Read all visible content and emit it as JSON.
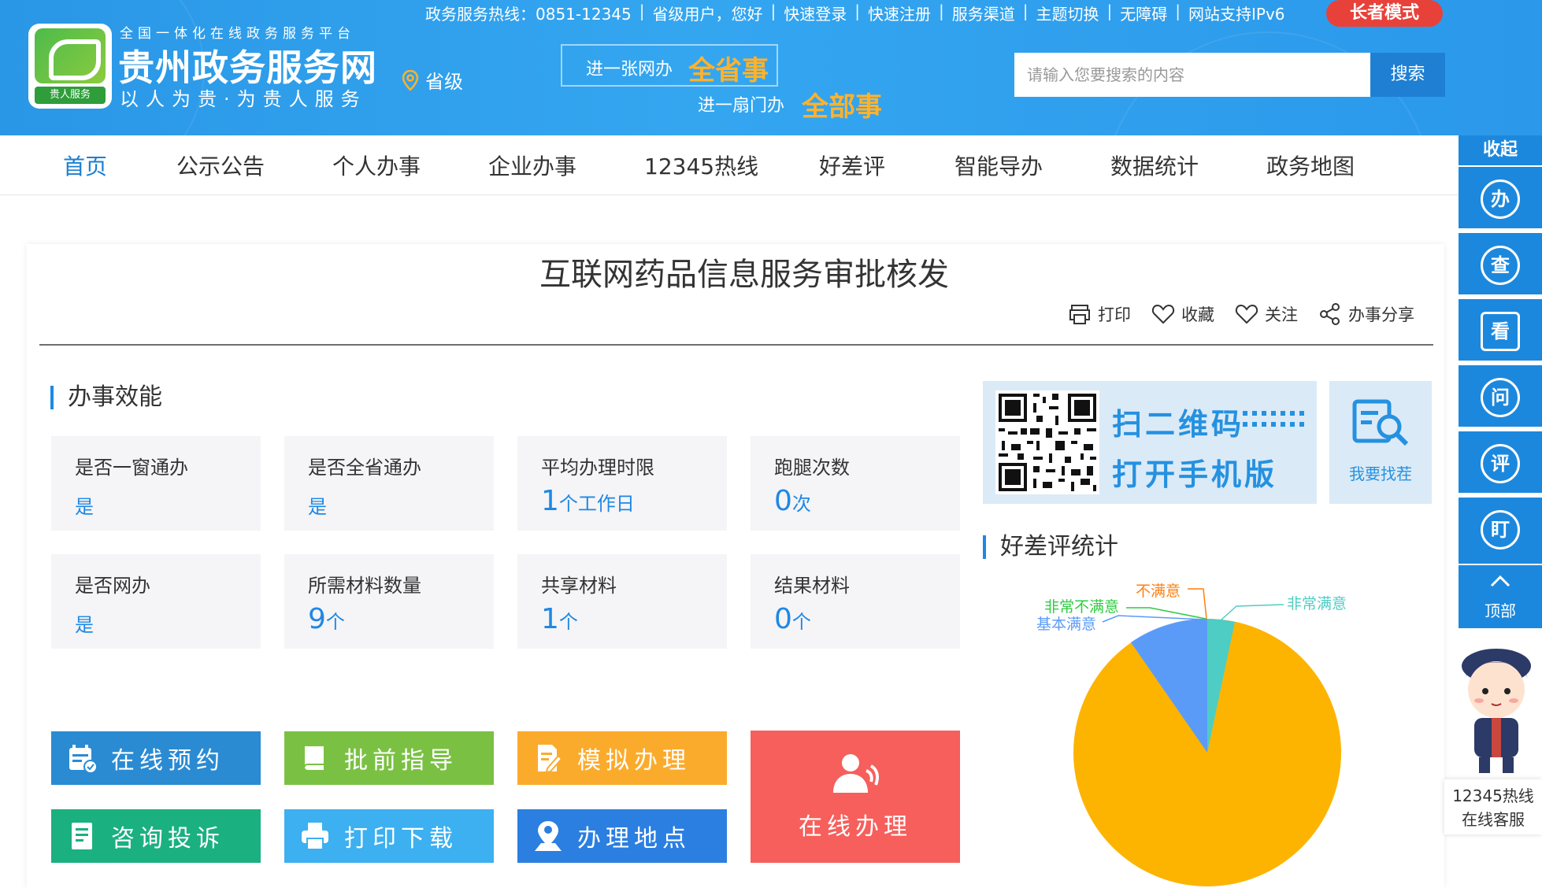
{
  "header": {
    "logo_tag": "贵人服务",
    "logo_sup": "全国一体化在线政务服务平台",
    "site_title": "贵州政务服务网",
    "slogan": "以人为贵·为贵人服务",
    "region": "省级",
    "banner_line1_prefix": "进一张网办",
    "banner_line1_highlight": "全省事",
    "banner_line2_prefix": "进一扇门办",
    "banner_line2_highlight": "全部事",
    "search_placeholder": "请输入您要搜索的内容",
    "search_button": "搜索"
  },
  "topbar": {
    "hotline": "政务服务热线：0851-12345",
    "greeting": "省级用户，您好",
    "links": [
      "快速登录",
      "快速注册",
      "服务渠道",
      "主题切换",
      "无障碍",
      "网站支持IPv6"
    ],
    "elder_mode": "长者模式"
  },
  "nav": {
    "items": [
      "首页",
      "公示公告",
      "个人办事",
      "企业办事",
      "12345热线",
      "好差评",
      "智能导办",
      "数据统计",
      "政务地图"
    ],
    "active_index": 0
  },
  "page": {
    "title": "互联网药品信息服务审批核发",
    "actions": [
      "打印",
      "收藏",
      "关注",
      "办事分享"
    ]
  },
  "efficiency": {
    "heading": "办事效能",
    "stats": [
      {
        "label": "是否一窗通办",
        "value": "是",
        "unit": ""
      },
      {
        "label": "是否全省通办",
        "value": "是",
        "unit": ""
      },
      {
        "label": "平均办理时限",
        "value": "1",
        "unit": "个工作日"
      },
      {
        "label": "跑腿次数",
        "value": "0",
        "unit": "次"
      },
      {
        "label": "是否网办",
        "value": "是",
        "unit": ""
      },
      {
        "label": "所需材料数量",
        "value": "9",
        "unit": "个"
      },
      {
        "label": "共享材料",
        "value": "1",
        "unit": "个"
      },
      {
        "label": "结果材料",
        "value": "0",
        "unit": "个"
      }
    ]
  },
  "buttons": {
    "online_booking": "在线预约",
    "pre_guidance": "批前指导",
    "simulate": "模拟办理",
    "online_handle": "在线办理",
    "consult": "咨询投诉",
    "print_download": "打印下载",
    "location": "办理地点"
  },
  "qr": {
    "line1": "扫二维码",
    "line2": "打开手机版",
    "find_label": "我要找茬"
  },
  "evaluation": {
    "heading": "好差评统计",
    "labels": [
      "非常满意",
      "不满意",
      "非常不满意",
      "基本满意"
    ],
    "colors": {
      "very_satisfied": "#4ecdc4",
      "dissatisfied": "#ff7f0e",
      "very_dissatisfied": "#2ecc40",
      "basically_satisfied": "#5b9bf8",
      "satisfied": "#fdb400"
    }
  },
  "sidebar": {
    "collapse": "收起",
    "buttons": [
      "办",
      "查",
      "看",
      "问",
      "评",
      "盯"
    ],
    "top": "顶部",
    "hotline_line1": "12345热线",
    "hotline_line2": "在线客服"
  },
  "colors": {
    "primary": "#1e88e5",
    "header_blue": "#2a97e6",
    "elder_red": "#e8413a",
    "btn_blue": "#2a8bd3",
    "btn_green": "#7ac143",
    "btn_orange": "#fbab2c",
    "btn_red": "#f65f5b",
    "btn_teal": "#1bb07f",
    "btn_lightblue": "#3cb0f0",
    "btn_darkblue": "#2b7fe0"
  }
}
